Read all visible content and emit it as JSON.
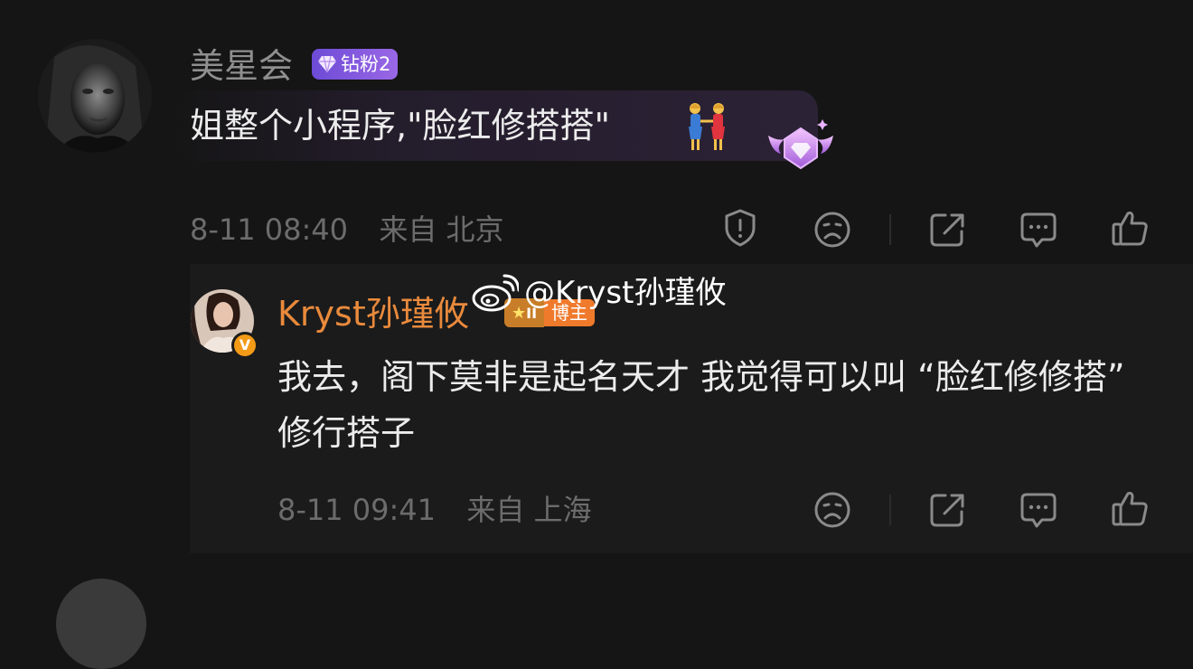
{
  "comment": {
    "username": "美星会",
    "fan_badge": "钻粉2",
    "text": "姐整个小程序,\"脸红修搭搭\"",
    "emoji": "two-women-holding-hands",
    "time": "8-11 08:40",
    "location": "来自 北京"
  },
  "reply": {
    "username": "Kryst孙瑾攸",
    "verified_mark": "V",
    "badge_level": "II",
    "badge_label": "博主",
    "text": "我去，阁下莫非是起名天才 我觉得可以叫 “脸红修修搭” 修行搭子",
    "time": "8-11 09:41",
    "location": "来自 上海"
  },
  "watermark": {
    "text": "@Kryst孙瑾攸",
    "icon": "weibo-logo-icon"
  },
  "icons": {
    "report": "report-icon",
    "dislike": "dislike-face-icon",
    "share": "share-icon",
    "comment": "comment-icon",
    "like": "thumbs-up-icon"
  },
  "colors": {
    "background": "#151515",
    "reply_background": "#1b1b1b",
    "username_gray": "#8f8f8f",
    "blogger_orange": "#e98a3c",
    "fan_badge_purple": "#7b56dc",
    "meta_gray": "#6c6c6c"
  }
}
